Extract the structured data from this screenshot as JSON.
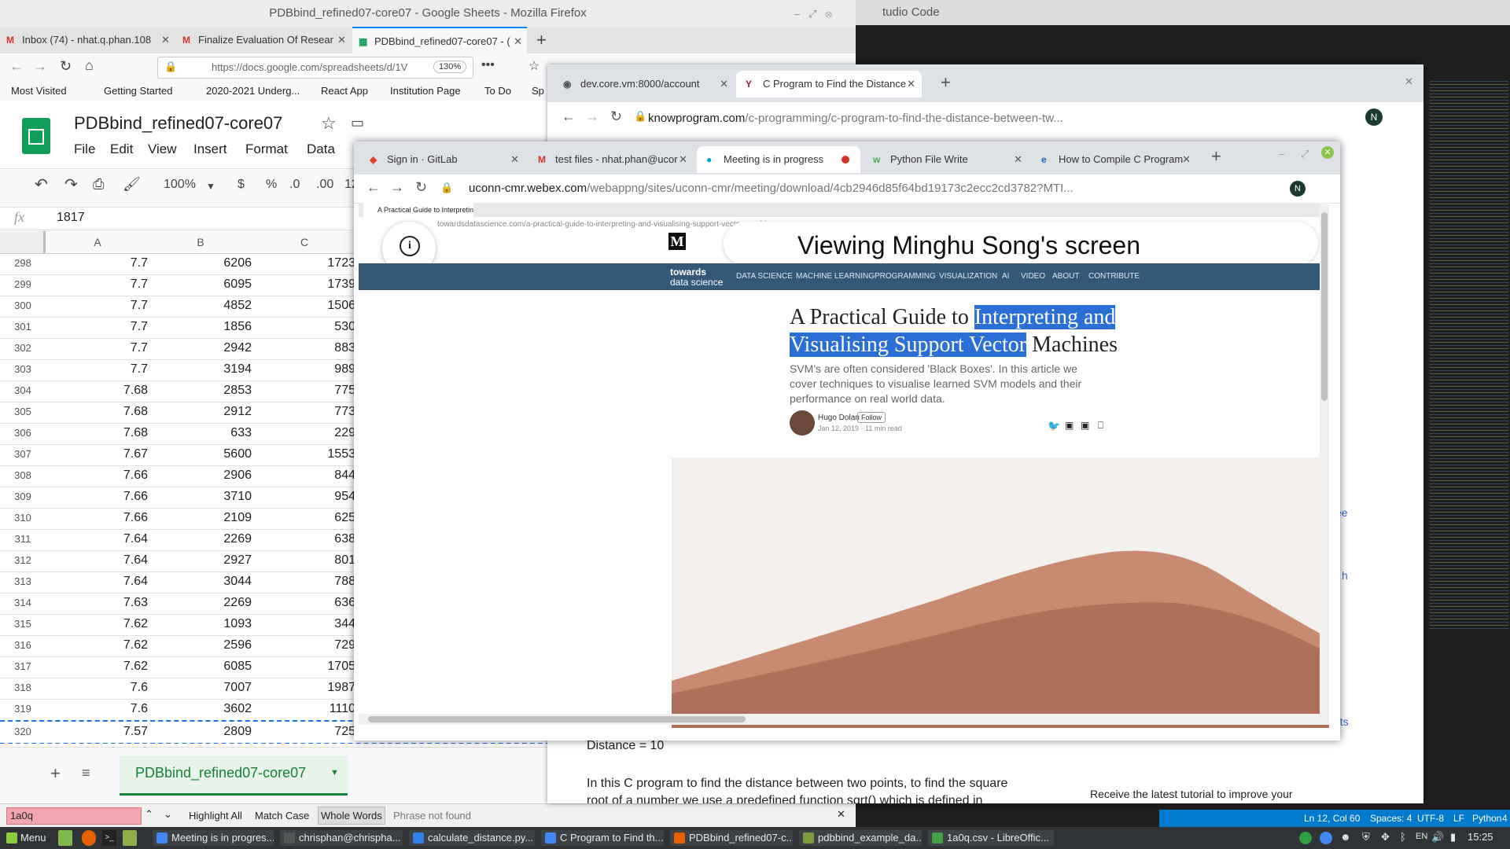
{
  "vscode": {
    "title": "tudio Code",
    "status": {
      "position": "Ln 12, Col 60",
      "spaces": "Spaces: 4",
      "encoding": "UTF-8",
      "eol": "LF",
      "language": "Python",
      "notif": "4"
    }
  },
  "firefox": {
    "window_title": "PDBbind_refined07-core07 - Google Sheets - Mozilla Firefox",
    "tabs": [
      {
        "label": "Inbox (74) - nhat.q.phan.108",
        "icon": "gmail-icon"
      },
      {
        "label": "Finalize Evaluation Of Resear",
        "icon": "gmail-icon"
      },
      {
        "label": "PDBbind_refined07-core07 - (",
        "icon": "sheets-icon"
      }
    ],
    "url": "https://docs.google.com/spreadsheets/d/1V",
    "zoom": "130%",
    "bookmarks": [
      "Most Visited",
      "Getting Started",
      "2020-2021 Underg...",
      "React App",
      "Institution Page",
      "To Do",
      "Sp"
    ]
  },
  "sheets": {
    "doc_title": "PDBbind_refined07-core07",
    "menu": [
      "File",
      "Edit",
      "View",
      "Insert",
      "Format",
      "Data"
    ],
    "zoom": "100%",
    "toolbar_symbols": [
      "$",
      "%",
      ".0",
      ".00",
      "12"
    ],
    "fx_label": "fx",
    "formula_value": "1817",
    "columns": [
      "A",
      "B",
      "C"
    ],
    "rows": [
      {
        "n": "298",
        "a": "7.7",
        "b": "6206",
        "c": "1723"
      },
      {
        "n": "299",
        "a": "7.7",
        "b": "6095",
        "c": "1739"
      },
      {
        "n": "300",
        "a": "7.7",
        "b": "4852",
        "c": "1506"
      },
      {
        "n": "301",
        "a": "7.7",
        "b": "1856",
        "c": "530"
      },
      {
        "n": "302",
        "a": "7.7",
        "b": "2942",
        "c": "883"
      },
      {
        "n": "303",
        "a": "7.7",
        "b": "3194",
        "c": "989"
      },
      {
        "n": "304",
        "a": "7.68",
        "b": "2853",
        "c": "775"
      },
      {
        "n": "305",
        "a": "7.68",
        "b": "2912",
        "c": "773"
      },
      {
        "n": "306",
        "a": "7.68",
        "b": "633",
        "c": "229"
      },
      {
        "n": "307",
        "a": "7.67",
        "b": "5600",
        "c": "1553"
      },
      {
        "n": "308",
        "a": "7.66",
        "b": "2906",
        "c": "844"
      },
      {
        "n": "309",
        "a": "7.66",
        "b": "3710",
        "c": "954"
      },
      {
        "n": "310",
        "a": "7.66",
        "b": "2109",
        "c": "625"
      },
      {
        "n": "311",
        "a": "7.64",
        "b": "2269",
        "c": "638"
      },
      {
        "n": "312",
        "a": "7.64",
        "b": "2927",
        "c": "801"
      },
      {
        "n": "313",
        "a": "7.64",
        "b": "3044",
        "c": "788"
      },
      {
        "n": "314",
        "a": "7.63",
        "b": "2269",
        "c": "636"
      },
      {
        "n": "315",
        "a": "7.62",
        "b": "1093",
        "c": "344"
      },
      {
        "n": "316",
        "a": "7.62",
        "b": "2596",
        "c": "729"
      },
      {
        "n": "317",
        "a": "7.62",
        "b": "6085",
        "c": "1705"
      },
      {
        "n": "318",
        "a": "7.6",
        "b": "7007",
        "c": "1987"
      },
      {
        "n": "319",
        "a": "7.6",
        "b": "3602",
        "c": "1110"
      },
      {
        "n": "320",
        "a": "7.57",
        "b": "2809",
        "c": "725"
      }
    ],
    "sheet_tab": "PDBbind_refined07-core07"
  },
  "findbar": {
    "query": "1a0q",
    "highlight_all": "Highlight All",
    "match_case": "Match Case",
    "whole_words": "Whole Words",
    "status": "Phrase not found"
  },
  "knowprogram": {
    "tabs": [
      {
        "label": "dev.core.vm:8000/account"
      },
      {
        "label": "C Program to Find the Distance"
      }
    ],
    "url_host": "knowprogram.com",
    "url_path": "/c-programming/c-program-to-find-the-distance-between-tw...",
    "body_line1": "Distance = 10",
    "body_line2": "In this C program to find the distance between two points, to find the square",
    "body_line3": "root of a number we use a predefined function sqrt() which is defined in",
    "sidebar_text": "Receive the latest tutorial to improve your",
    "side_fragments": [
      "ee",
      "h",
      "nts"
    ]
  },
  "webex": {
    "tabs": [
      {
        "label": "Sign in · GitLab",
        "icon": "gitlab-icon"
      },
      {
        "label": "test files - nhat.phan@ucor",
        "icon": "gmail-icon"
      },
      {
        "label": "Meeting is in progress",
        "icon": "webex-icon"
      },
      {
        "label": "Python File Write",
        "icon": "w3-icon"
      },
      {
        "label": "How to Compile C Program",
        "icon": "e-icon"
      }
    ],
    "url_host": "uconn-cmr.webex.com",
    "url_path": "/webappng/sites/uconn-cmr/meeting/download/4cb2946d85f64bd19173c2ecc2cd3782?MTI...",
    "viewing_banner": "Viewing Minghu Song's screen"
  },
  "shared_screen": {
    "tab_label": "A Practical Guide to Interpreting",
    "url": "towardsdatascience.com/a-practical-guide-to-interpreting-and-visualising-support-vector-machines-",
    "logo_letter": "M",
    "brand_line1": "towards",
    "brand_line2": "data science",
    "nav": [
      "DATA SCIENCE",
      "MACHINE LEARNING",
      "PROGRAMMING",
      "VISUALIZATION",
      "AI",
      "VIDEO",
      "ABOUT",
      "CONTRIBUTE"
    ],
    "article_title_1a": "A Practical Guide to ",
    "article_title_1b": "Interpreting and",
    "article_title_2a": "Visualising Support Vector",
    "article_title_2b": " Machines",
    "subtitle": "SVM's are often considered 'Black Boxes'. In this article we cover techniques to visualise learned SVM models and their performance on real world data.",
    "author": "Hugo Dolan",
    "follow": "Follow",
    "date": "Jan 12, 2019 · 11 min read"
  },
  "taskbar": {
    "menu": "Menu",
    "windows": [
      {
        "label": "Meeting is in progres...",
        "color": "#4285f4"
      },
      {
        "label": "chrisphan@chrispha...",
        "color": "#555555"
      },
      {
        "label": "calculate_distance.py...",
        "color": "#2f80ed"
      },
      {
        "label": "C Program to Find th...",
        "color": "#4285f4"
      },
      {
        "label": "PDBbind_refined07-c...",
        "color": "#e66000"
      },
      {
        "label": "pdbbind_example_da...",
        "color": "#7d9a3c"
      },
      {
        "label": "1a0q.csv - LibreOffic...",
        "color": "#43a047"
      }
    ],
    "lang": "EN",
    "time": "15:25"
  }
}
